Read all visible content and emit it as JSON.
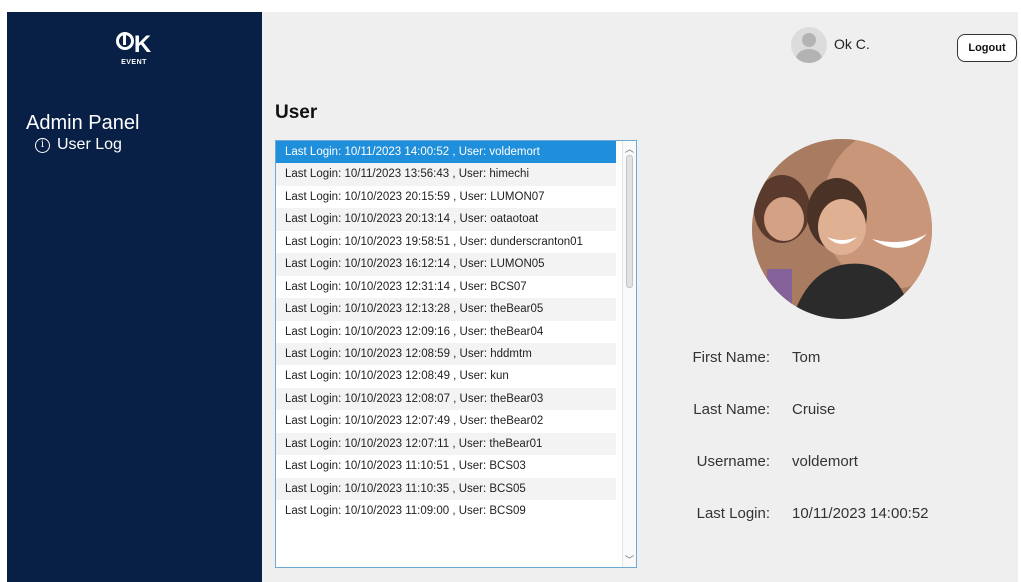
{
  "brand": {
    "mark": "K",
    "sub": "EVENT"
  },
  "sidebar": {
    "title": "Admin Panel",
    "items": [
      {
        "label": "User Log",
        "icon": "info-icon"
      }
    ]
  },
  "header": {
    "user_name": "Ok C.",
    "logout_label": "Logout"
  },
  "main": {
    "title": "User",
    "log_entries": [
      "Last Login: 10/11/2023 14:00:52 , User: voldemort",
      "Last Login: 10/11/2023 13:56:43 , User: himechi",
      "Last Login: 10/10/2023 20:15:59 , User: LUMON07",
      "Last Login: 10/10/2023 20:13:14 , User: oataotoat",
      "Last Login: 10/10/2023 19:58:51 , User: dunderscranton01",
      "Last Login: 10/10/2023 16:12:14 , User: LUMON05",
      "Last Login: 10/10/2023 12:31:14 , User: BCS07",
      "Last Login: 10/10/2023 12:13:28 , User: theBear05",
      "Last Login: 10/10/2023 12:09:16 , User: theBear04",
      "Last Login: 10/10/2023 12:08:59 , User: hddmtm",
      "Last Login: 10/10/2023 12:08:49 , User: kun",
      "Last Login: 10/10/2023 12:08:07 , User: theBear03",
      "Last Login: 10/10/2023 12:07:49 , User: theBear02",
      "Last Login: 10/10/2023 12:07:11 , User: theBear01",
      "Last Login: 10/10/2023 11:10:51 , User: BCS03",
      "Last Login: 10/10/2023 11:10:35 , User: BCS05",
      "Last Login: 10/10/2023 11:09:00 , User: BCS09"
    ],
    "selected_index": 0
  },
  "details": {
    "first_name_label": "First Name:",
    "first_name": "Tom",
    "last_name_label": "Last Name:",
    "last_name": "Cruise",
    "username_label": "Username:",
    "username": "voldemort",
    "last_login_label": "Last Login:",
    "last_login": "10/11/2023 14:00:52"
  },
  "colors": {
    "sidebar": "#082046",
    "selection": "#1f8fdb",
    "background": "#efefef"
  }
}
